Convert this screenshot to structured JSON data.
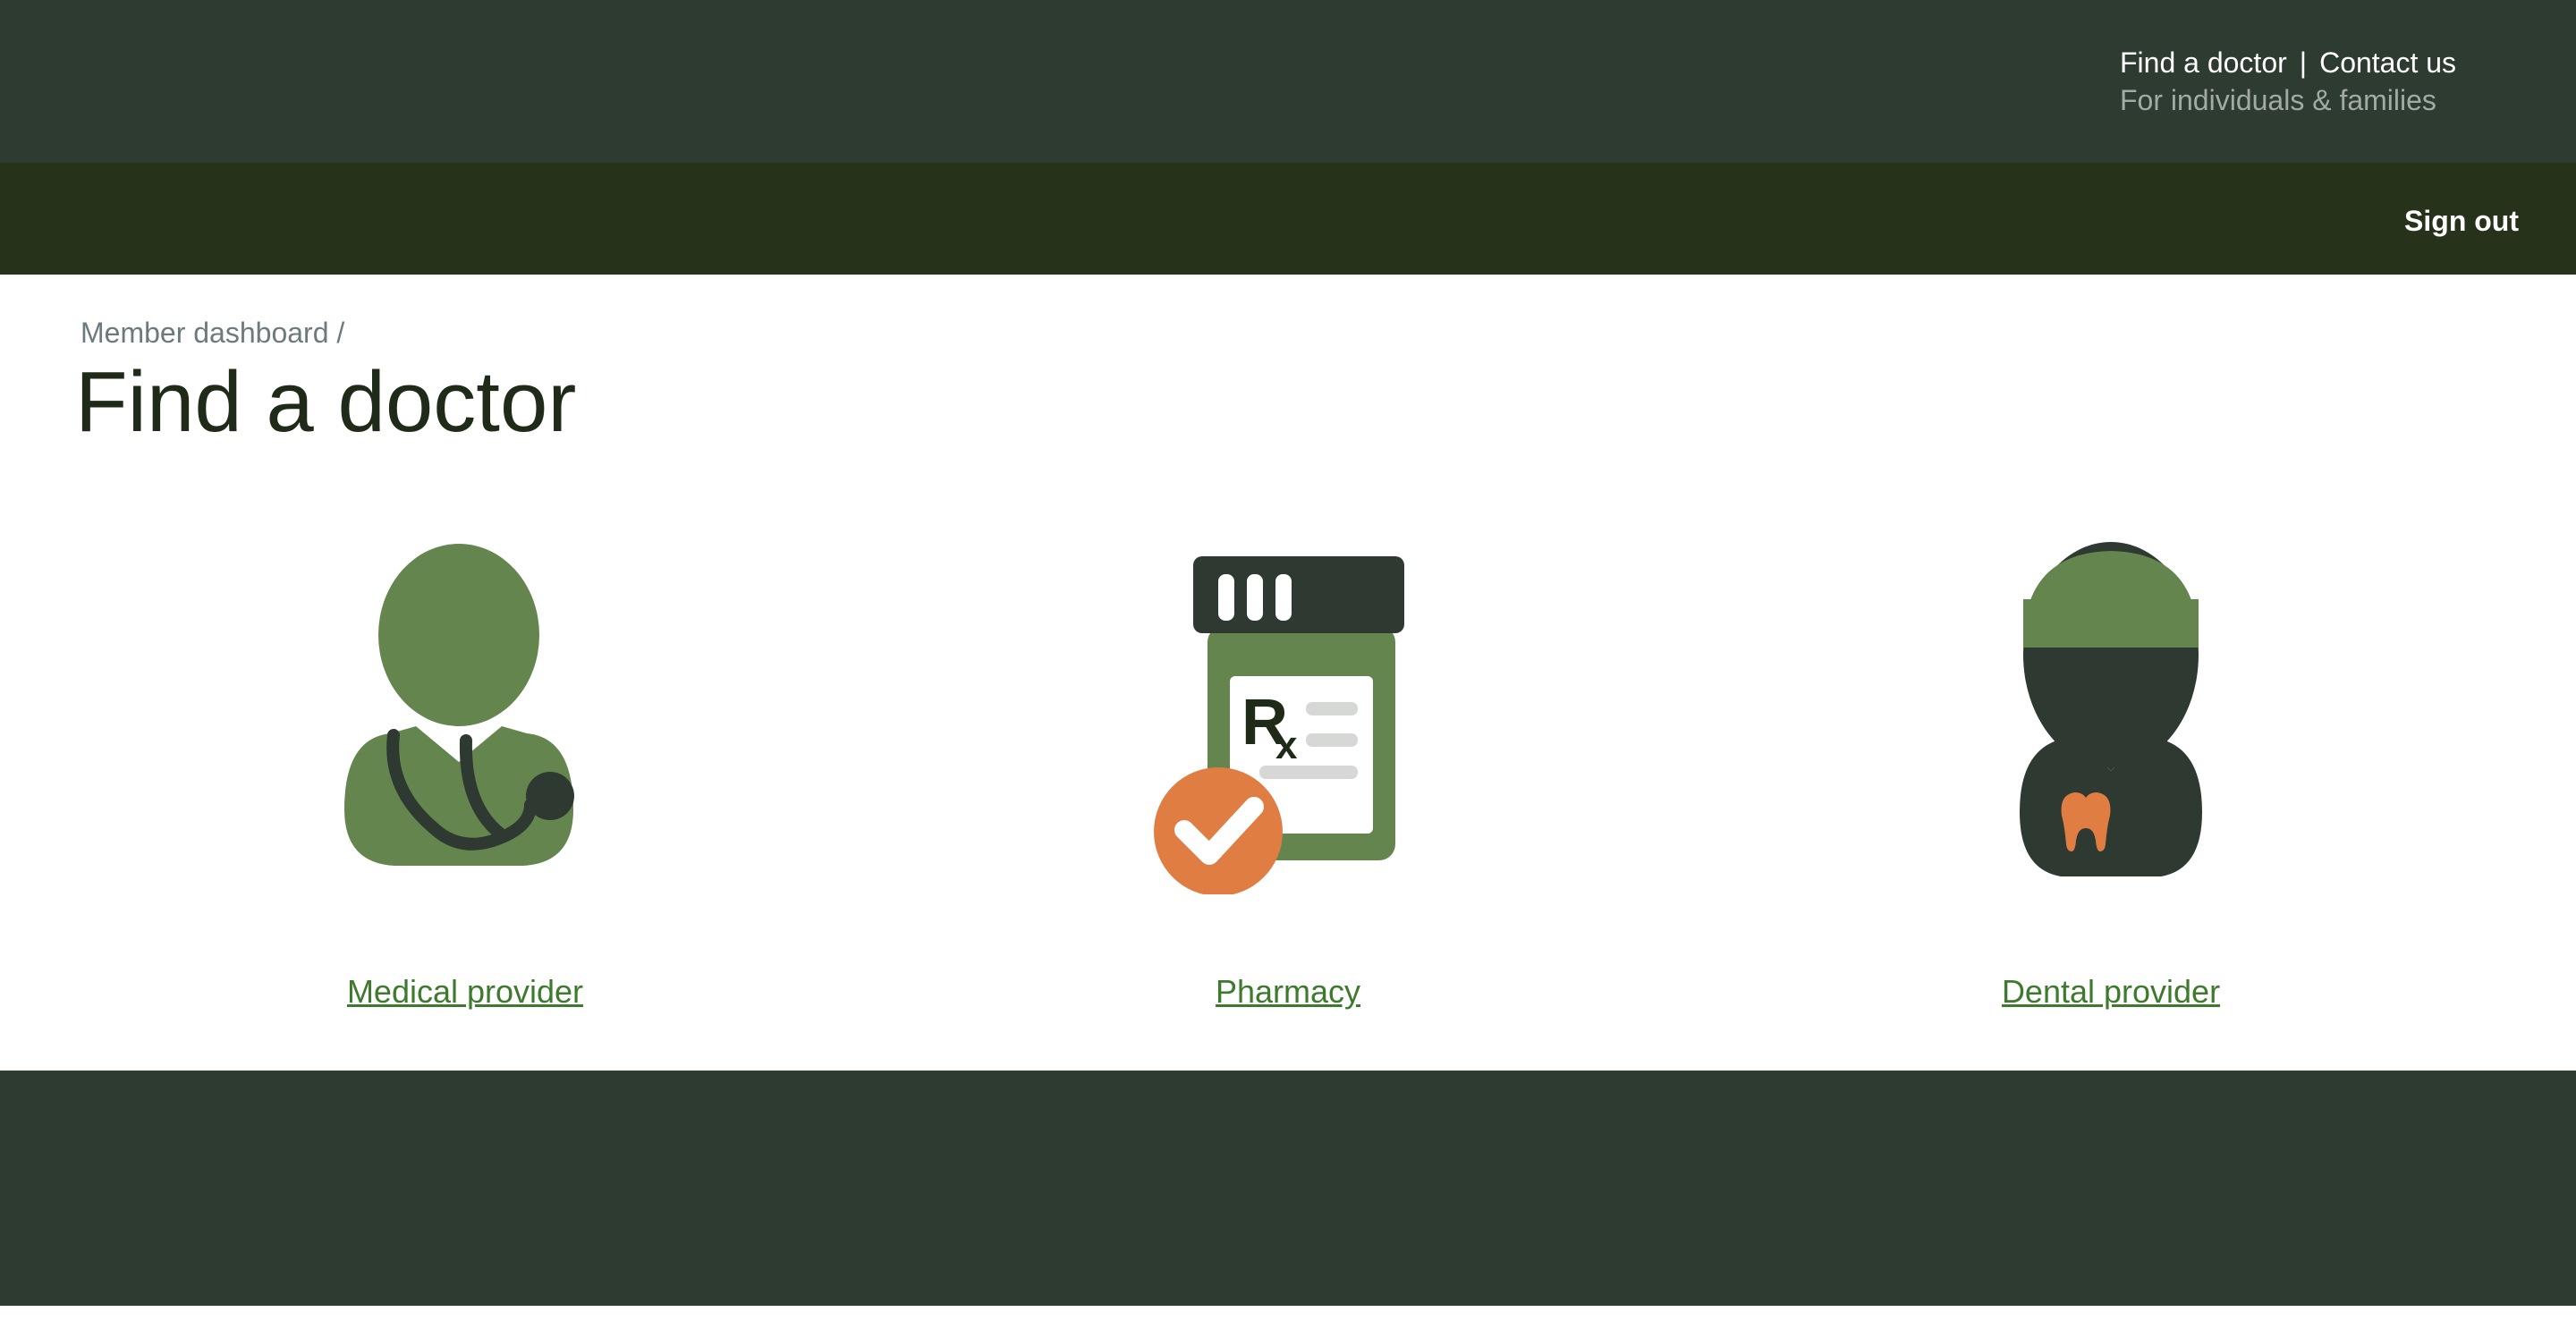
{
  "header": {
    "utility_links": [
      "Find a doctor",
      "Contact us"
    ],
    "separator": "|",
    "audience": "For individuals & families",
    "sign_out_label": "Sign out"
  },
  "breadcrumb": {
    "parent": "Member dashboard",
    "separator": "/"
  },
  "page": {
    "title": "Find a doctor"
  },
  "options": [
    {
      "label": "Medical provider",
      "icon": "doctor-stethoscope-icon"
    },
    {
      "label": "Pharmacy",
      "icon": "prescription-bottle-icon"
    },
    {
      "label": "Dental provider",
      "icon": "dentist-icon"
    }
  ],
  "colors": {
    "top_bar": "#2e3b31",
    "main_bar": "#27321b",
    "footer": "#2e3b31",
    "link": "#3e7a2e",
    "icon_green": "#65854f",
    "icon_dark": "#2e3a31",
    "icon_orange": "#e07d43"
  }
}
